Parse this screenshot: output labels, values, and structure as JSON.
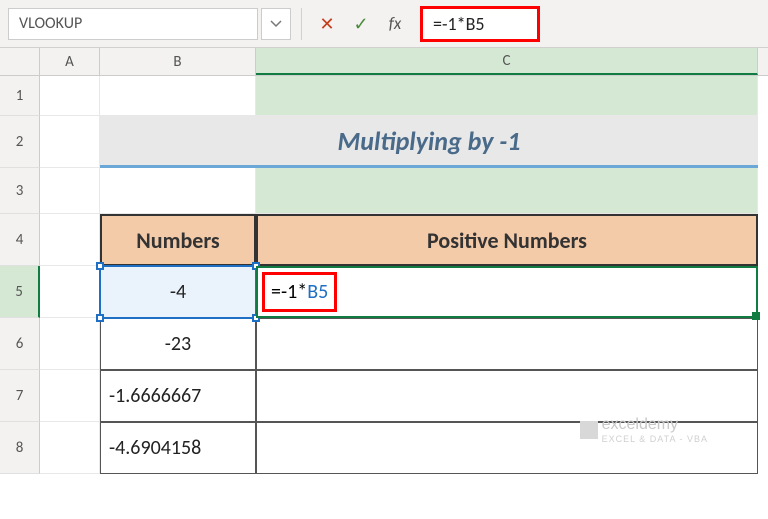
{
  "name_box": "VLOOKUP",
  "formula_bar": {
    "cancel": "✕",
    "enter": "✓",
    "fx": "fx",
    "formula": "=-1*B5"
  },
  "columns": {
    "A": "A",
    "B": "B",
    "C": "C"
  },
  "rows": {
    "r1": "1",
    "r2": "2",
    "r3": "3",
    "r4": "4",
    "r5": "5",
    "r6": "6",
    "r7": "7",
    "r8": "8"
  },
  "title": "Multiplying by -1",
  "headers": {
    "numbers": "Numbers",
    "positive": "Positive Numbers"
  },
  "data": {
    "b5": "-4",
    "b6": "-23",
    "b7": "-1.6666667",
    "b8": "-4.6904158",
    "c5_prefix": "=-1*",
    "c5_ref": "B5"
  },
  "watermark": {
    "main": "exceldemy",
    "sub": "EXCEL & DATA - VBA"
  }
}
